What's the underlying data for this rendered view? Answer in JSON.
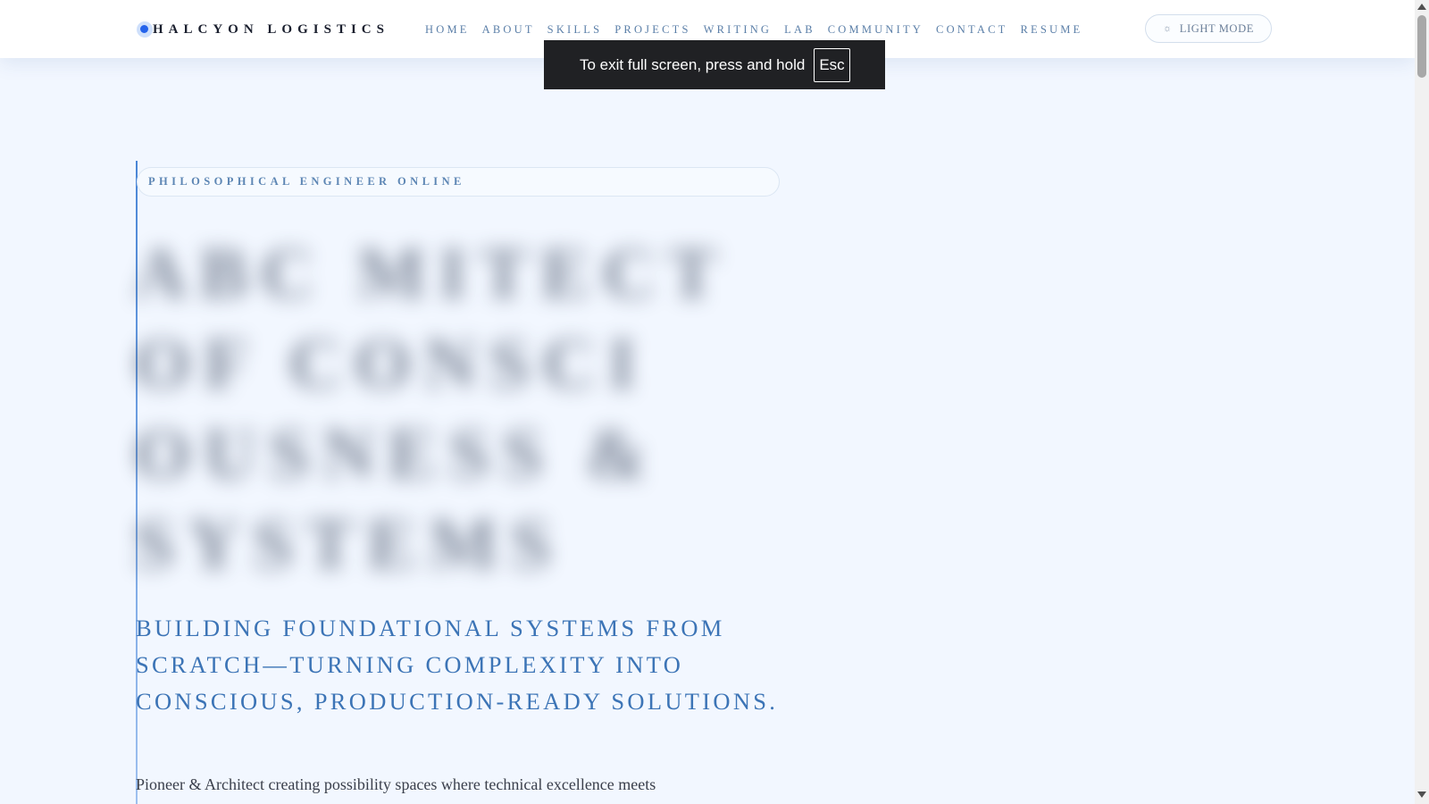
{
  "header": {
    "brand": "HALCYON LOGISTICS",
    "nav": [
      "HOME",
      "ABOUT",
      "SKILLS",
      "PROJECTS",
      "WRITING",
      "LAB",
      "COMMUNITY",
      "CONTACT",
      "RESUME"
    ],
    "mode_toggle": {
      "icon": "sun-icon",
      "label": "LIGHT MODE"
    }
  },
  "fullscreen_toast": {
    "message": "To exit full screen, press and hold",
    "key": "Esc"
  },
  "hero": {
    "tagline": "PHILOSOPHICAL ENGINEER ONLINE",
    "subtitle": "BUILDING FOUNDATIONAL SYSTEMS FROM SCRATCH—TURNING COMPLEXITY INTO CONSCIOUS, PRODUCTION-READY SOLUTIONS.",
    "intro": "Pioneer & Architect creating possibility spaces where technical excellence meets"
  },
  "colors": {
    "accent": "#2563eb",
    "subtitle": "#3c74b6",
    "background": "#f2f7ff"
  }
}
